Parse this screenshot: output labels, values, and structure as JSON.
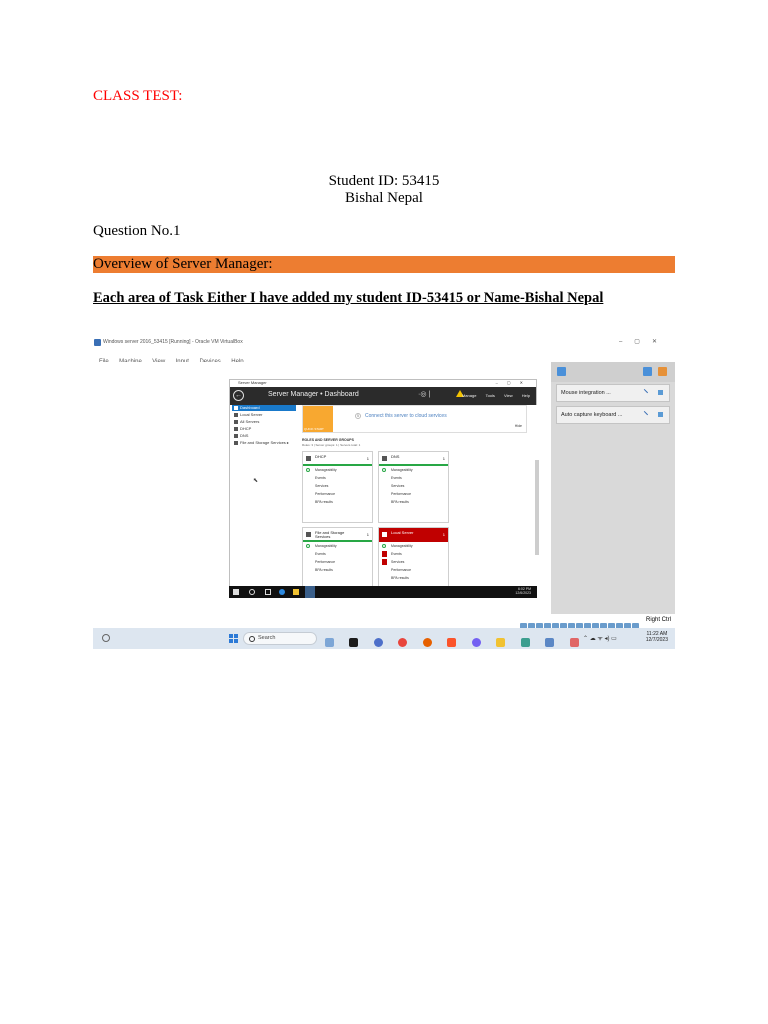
{
  "document": {
    "class_test": "CLASS TEST:",
    "student_id": "Student ID: 53415",
    "student_name": "Bishal Nepal",
    "question": "Question No.1",
    "overview": "Overview of Server Manager:",
    "task_heading": "Each area of Task Either I have added my student ID-53415 or Name-Bishal Nepal"
  },
  "colors": {
    "class_test_text": "#ff0000",
    "overview_highlight": "#ed7d31"
  },
  "screenshot": {
    "vbox_window_title": "Windows server 2016_53415 [Running] - Oracle VM VirtualBox",
    "vbox_menu": [
      "File",
      "Machine",
      "View",
      "Input",
      "Devices",
      "Help"
    ],
    "server_manager": {
      "window_title": "Server Manager",
      "header_title": "Server Manager • Dashboard",
      "header_menu": [
        "Manage",
        "Tools",
        "View",
        "Help"
      ],
      "nav": [
        {
          "label": "Dashboard",
          "active": true
        },
        {
          "label": "Local Server",
          "active": false
        },
        {
          "label": "All Servers",
          "active": false
        },
        {
          "label": "DHCP",
          "active": false
        },
        {
          "label": "DNS",
          "active": false
        },
        {
          "label": "File and Storage Services ▸",
          "active": false
        }
      ],
      "quick_start_label": "QUICK START",
      "quick_start_num": "5",
      "quick_start_link": "Connect this server to cloud services",
      "hide": "Hide",
      "roles_title": "ROLES AND SERVER GROUPS",
      "roles_sub": "Roles: 3  |  Server groups: 1  |  Servers total: 1",
      "tiles": [
        {
          "title": "DHCP",
          "count": "1",
          "rows": [
            "Manageability",
            "Events",
            "Services",
            "Performance",
            "BPA results"
          ]
        },
        {
          "title": "DNS",
          "count": "1",
          "rows": [
            "Manageability",
            "Events",
            "Services",
            "Performance",
            "BPA results"
          ]
        },
        {
          "title": "File and Storage Services",
          "count": "1",
          "rows": [
            "Manageability",
            "Events",
            "Performance",
            "BPA results"
          ]
        },
        {
          "title": "Local Server",
          "count": "1",
          "rows": [
            "Manageability",
            "Events",
            "Services",
            "Performance",
            "BPA results"
          ]
        }
      ],
      "guest_time": "6:02 PM",
      "guest_date": "12/6/2023"
    },
    "vbox_side": {
      "items": [
        "Mouse integration ...",
        "Auto capture keyboard ..."
      ]
    },
    "status_host_key": "Right Ctrl",
    "host_taskbar": {
      "search": "Search",
      "time": "11:22 AM",
      "date": "12/7/2023"
    }
  }
}
